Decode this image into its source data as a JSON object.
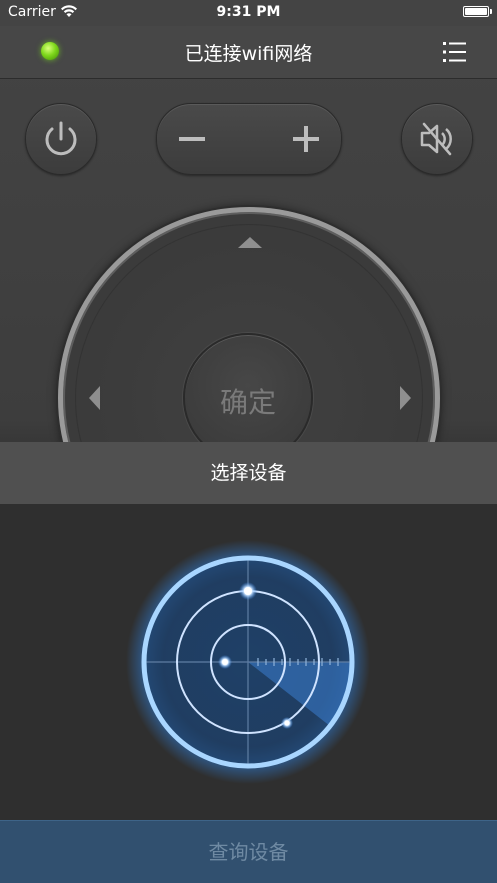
{
  "status_bar": {
    "carrier": "Carrier",
    "wifi_icon": "wifi-icon",
    "time": "9:31 PM",
    "battery_icon": "battery-icon"
  },
  "nav": {
    "status_led_color": "#7fd81c",
    "title": "已连接wifi网络",
    "menu_icon": "list-menu-icon"
  },
  "controls": {
    "power_icon": "power-icon",
    "volume_minus": "−",
    "volume_plus": "+",
    "mute_icon": "mute-icon"
  },
  "dpad": {
    "up_icon": "arrow-up-icon",
    "left_icon": "arrow-left-icon",
    "right_icon": "arrow-right-icon",
    "ok_label": "确定"
  },
  "device_panel": {
    "header": "选择设备",
    "radar_icon": "radar-icon",
    "query_button": "查询设备"
  },
  "colors": {
    "radar_ring": "#a9d6ff",
    "radar_glow": "#2f7dd6",
    "query_bg": "#31506f"
  }
}
